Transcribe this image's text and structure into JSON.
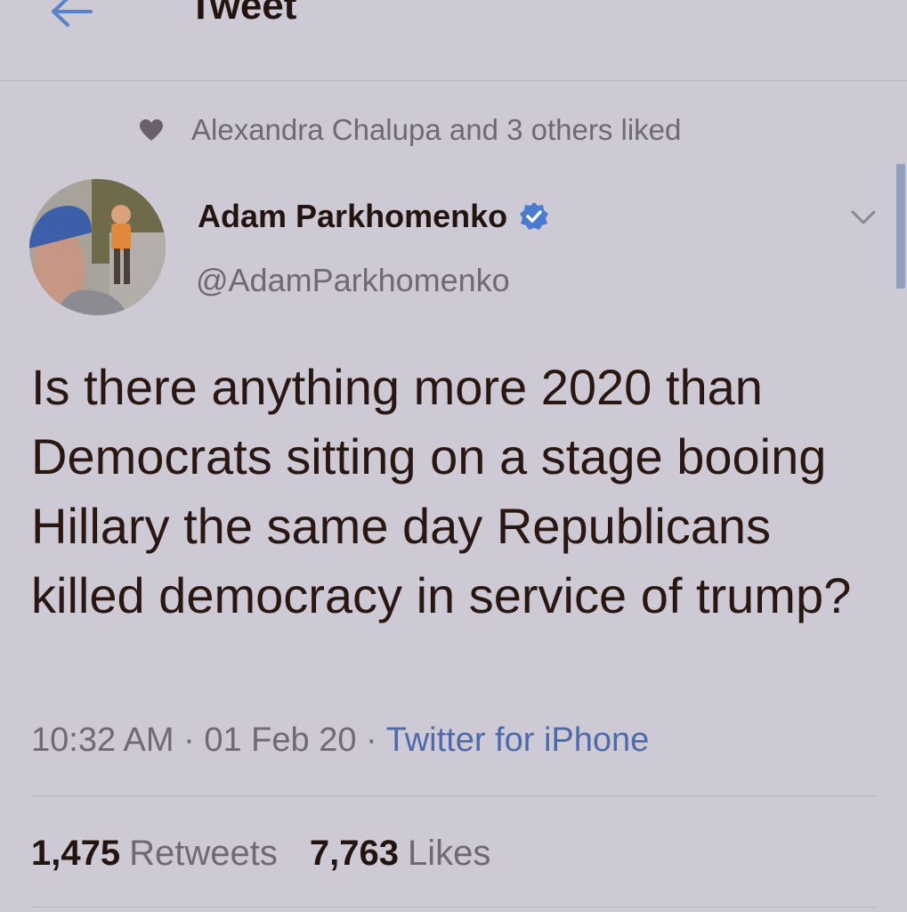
{
  "header": {
    "title": "Tweet",
    "back_icon": "arrow-left-icon"
  },
  "social_context": {
    "icon": "heart-icon",
    "text": "Alexandra Chalupa and 3 others liked"
  },
  "author": {
    "name": "Adam Parkhomenko",
    "handle": "@AdamParkhomenko",
    "verified": true,
    "verified_icon": "verified-badge-icon"
  },
  "tweet": {
    "text": "Is there anything more 2020 than Democrats sitting on a stage booing Hillary the same day Republicans killed democracy in service of trump?",
    "time": "10:32 AM",
    "separator": "·",
    "date": "01 Feb 20",
    "source": "Twitter for iPhone"
  },
  "stats": {
    "retweets_count": "1,475",
    "retweets_label": "Retweets",
    "likes_count": "7,763",
    "likes_label": "Likes"
  },
  "colors": {
    "background": "#cdcad6",
    "text": "#2a1712",
    "muted": "#6f6972",
    "link": "#4f6aa8",
    "verified": "#4a7bd0",
    "back_arrow": "#5b82c8"
  }
}
